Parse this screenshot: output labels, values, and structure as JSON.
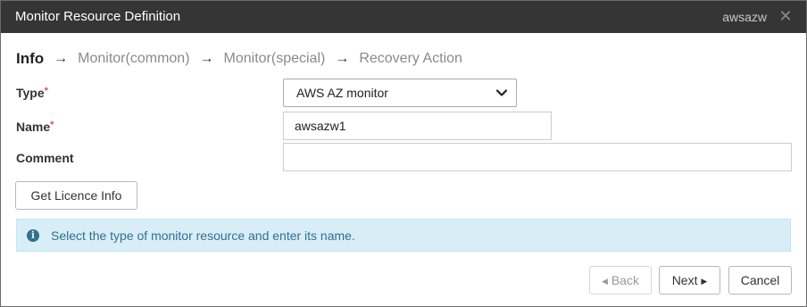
{
  "window": {
    "title": "Monitor Resource Definition",
    "resource_name": "awsazw",
    "close_glyph": "✕"
  },
  "steps": [
    {
      "label": "Info",
      "active": true
    },
    {
      "label": "Monitor(common)",
      "active": false
    },
    {
      "label": "Monitor(special)",
      "active": false
    },
    {
      "label": "Recovery Action",
      "active": false
    }
  ],
  "step_arrow": "→",
  "form": {
    "type_label": "Type",
    "type_value": "AWS AZ monitor",
    "name_label": "Name",
    "name_value": "awsazw1",
    "comment_label": "Comment",
    "comment_value": "",
    "required_mark": "*"
  },
  "buttons": {
    "licence": "Get Licence Info",
    "back": "Back",
    "next": "Next",
    "cancel": "Cancel",
    "back_glyph": "◀",
    "next_glyph": "▶"
  },
  "alert": {
    "icon_glyph": "i",
    "message": "Select the type of monitor resource and enter its name."
  },
  "colors": {
    "titlebar": "#353535",
    "required": "#d9534f",
    "alert_bg": "#d9edf7",
    "alert_text": "#31708f"
  }
}
